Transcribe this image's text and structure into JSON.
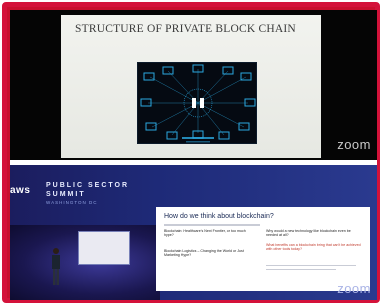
{
  "top_panel": {
    "slide_title": "STRUCTURE OF PRIVATE BLOCK CHAIN",
    "watermark": "zoom"
  },
  "bottom_panel": {
    "brand": "aws",
    "event_line1": "PUBLIC SECTOR",
    "event_line2": "SUMMIT",
    "event_line3": "WASHINGTON DC",
    "slide_title": "How do we think about blockchain?",
    "left_items": [
      "Blockchain: Healthcare's Next Frontier, or too much hype?",
      "Blockchain Logistics – Changing the World or Just Marketing Hype?"
    ],
    "right_items": [
      "Why would a new technology like blockchain even be needed at all?",
      "What benefits can a blockchain bring that can't be achieved with other tools today?"
    ],
    "watermark": "zoom"
  },
  "colors": {
    "border": "#d4123a",
    "summit_bg": "#1e2a78",
    "diagram_accent": "#2aa8e0"
  }
}
